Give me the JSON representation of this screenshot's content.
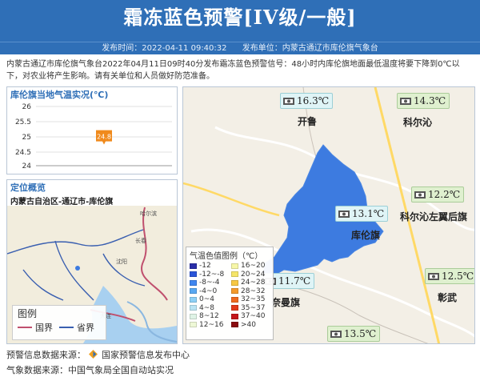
{
  "header": {
    "title": "霜冻蓝色预警[IV级/一般]"
  },
  "subbar": {
    "time": "发布时间：2022-04-11 09:40:32",
    "unit": "发布单位：内蒙古通辽市库伦旗气象台"
  },
  "summary": "内蒙古通辽市库伦旗气象台2022年04月11日09时40分发布霜冻蓝色预警信号：48小时内库伦旗地面最低温度将要下降到0℃以下，对农业将产生影响。请有关单位和人员做好防范准备。",
  "temp_panel": {
    "title": "库伦旗当地气温实况(℃)",
    "ticks": [
      "26",
      "25.5",
      "25",
      "24.5",
      "24"
    ],
    "xlabel": "9时",
    "value_label": "24.8"
  },
  "chart_data": {
    "type": "scatter",
    "title": "库伦旗当地气温实况(℃)",
    "x": [
      "9时"
    ],
    "values": [
      24.8
    ],
    "ylim": [
      24,
      26
    ],
    "yticks": [
      26,
      25.5,
      25,
      24.5,
      24
    ],
    "grid": true
  },
  "location": {
    "title": "定位概览",
    "path": "内蒙古自治区-通辽市-库伦旗",
    "legend_title": "图例",
    "legend_country": "国界",
    "legend_province": "省界",
    "country_color": "#c0506e",
    "province_color": "#3a5fb0",
    "city_labels": {
      "harbin": "哈尔滨",
      "changchun": "长春",
      "shenyang": "沈阳",
      "dalian": "大连"
    }
  },
  "map": {
    "places": {
      "kailu": "开鲁",
      "keerqin": "科尔沁",
      "kezuohou": "科尔沁左翼后旗",
      "kulun": "库伦旗",
      "naiman": "奈曼旗",
      "zhangwu": "彰武"
    },
    "stations": {
      "kailu": "16.3℃",
      "keerqin": "14.3℃",
      "kezuohou": "12.2℃",
      "kulun": "13.1℃",
      "naiman": "11.7℃",
      "zhangwu": "12.5℃",
      "south": "13.5℃"
    },
    "region_color": "#3d7be0",
    "legend": {
      "title": "气温色值图例（℃）",
      "items": [
        {
          "label": "-12",
          "color": "#2a2ea8"
        },
        {
          "label": "16~20",
          "color": "#f7f7a8"
        },
        {
          "label": "-12~-8",
          "color": "#2b55d9"
        },
        {
          "label": "20~24",
          "color": "#f5e56a"
        },
        {
          "label": "-8~-4",
          "color": "#3f86f0"
        },
        {
          "label": "24~28",
          "color": "#f7c843"
        },
        {
          "label": "-4~0",
          "color": "#58a8f2"
        },
        {
          "label": "28~32",
          "color": "#f49a2c"
        },
        {
          "label": "0~4",
          "color": "#8dd0f6"
        },
        {
          "label": "32~35",
          "color": "#ef6a1f"
        },
        {
          "label": "4~8",
          "color": "#b9e4f4"
        },
        {
          "label": "35~37",
          "color": "#e23a1a"
        },
        {
          "label": "8~12",
          "color": "#dff3e6"
        },
        {
          "label": "37~40",
          "color": "#c4151a"
        },
        {
          "label": "12~16",
          "color": "#eef8d6"
        },
        {
          "label": ">40",
          "color": "#8a0b10"
        }
      ]
    }
  },
  "footer": {
    "warning_source_label": "预警信息数据来源：",
    "warning_source": "国家预警信息发布中心",
    "weather_source": "气象数据来源：中国气象局全国自动站实况"
  }
}
